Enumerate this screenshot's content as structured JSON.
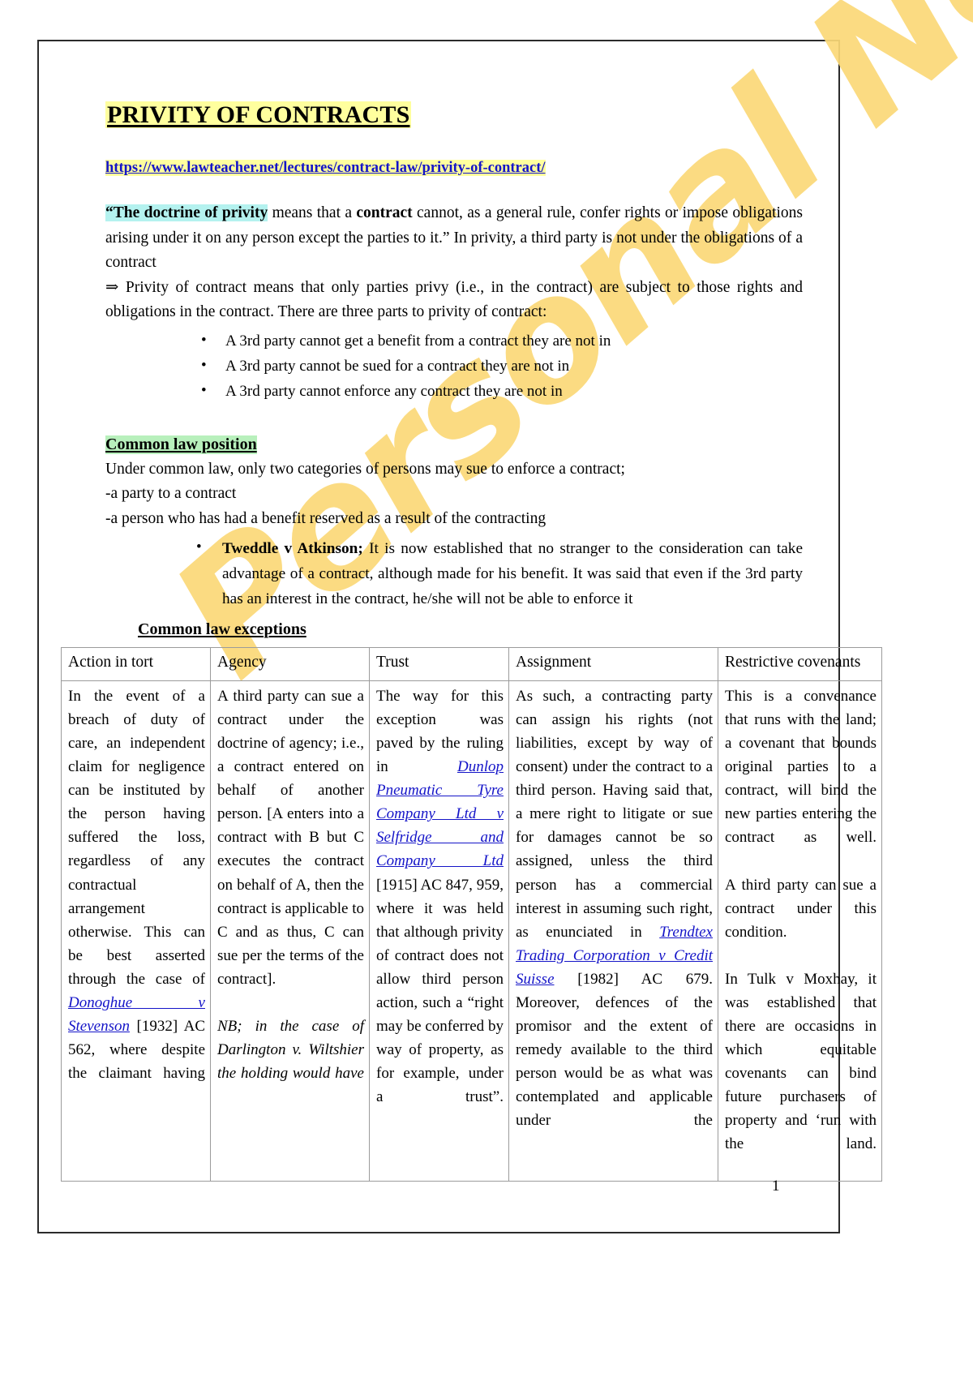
{
  "document": {
    "title": "PRIVITY OF CONTRACTS",
    "source_url": "https://www.lawteacher.net/lectures/contract-law/privity-of-contract/",
    "watermark": "Personal Notes",
    "page_number": "1",
    "colors": {
      "title_highlight": "#ffff9e",
      "url_highlight": "#ffff9e",
      "definition_highlight": "#b4f2ef",
      "section_highlight": "#b8f0bc",
      "link_blue": "#1414c8",
      "watermark": "#fbd978"
    }
  },
  "intro": {
    "definition_highlight": "“The doctrine of privity",
    "definition_rest_a": " means that a ",
    "definition_bold": "contract",
    "definition_rest_b": " cannot, as a general rule, confer rights or impose obligations arising under it on any person except the parties to it.” In privity, a third party is not under the obligations of a contract",
    "arrow_line": "⇒ Privity of contract means that only parties privy (i.e., in the contract) are subject to those rights and obligations in the contract. There are three parts to privity of contract:",
    "bullets": [
      "A 3rd party cannot get a benefit from a contract they are not in",
      "A 3rd party cannot be sued for a contract they are not in",
      "A 3rd party cannot enforce any contract they are not in"
    ]
  },
  "common_law": {
    "heading": "Common law position",
    "line1": "Under common law, only two categories of persons may sue to enforce a contract;",
    "line2": "-a party to a contract",
    "line3": "-a person who has had a benefit reserved as a result of the contracting",
    "case_bullet_bold": "Tweddle v Atkinson;",
    "case_bullet_text": " It is now established that no stranger to the consideration can take advantage of a contract, although made for his benefit. It was said that even if the 3rd party has an interest in the contract, he/she will not be able to enforce it"
  },
  "exceptions": {
    "heading": "Common law exceptions",
    "columns": [
      "Action in tort",
      "Agency",
      "Trust",
      "Assignment",
      "Restrictive covenants"
    ],
    "cells": {
      "action_in_tort": {
        "text_before_cite": "In the event of a breach of duty of care, an independent claim for negligence can be instituted by the person having suffered the loss, regardless of any contractual arrangement otherwise. This can be best asserted through the case of ",
        "cite": "Donoghue v Stevenson",
        "text_after_cite": " [1932] AC 562, where despite the claimant having"
      },
      "agency": {
        "text": "A third party can sue a contract under the doctrine of agency; i.e., a contract entered on behalf of another person. [A enters into a contract with B but C executes the contract on behalf of A, then the contract is applicable to C and as thus, C can sue per the terms of the contract].",
        "note_italic": "NB; in the case of Darlington v. Wiltshier the holding would have"
      },
      "trust": {
        "text_before_cite": "The way for this exception was paved by the ruling in ",
        "cite": "Dunlop Pneumatic Tyre Company Ltd v Selfridge and Company Ltd",
        "text_after_cite": " [1915] AC 847, 959, where it was held that although privity of contract does not allow third person action, such a “right may be conferred by way of property, as for example, under a trust”."
      },
      "assignment": {
        "text_before_cite": "As such, a contracting party can assign his rights (not liabilities, except by way of consent) under the contract to a third person. Having said that, a mere right to litigate or sue for damages cannot be so assigned, unless the third person has a commercial interest in assuming such right, as enunciated in ",
        "cite": "Trendtex Trading Corporation v Credit Suisse",
        "text_after_cite": " [1982] AC 679. Moreover, defences of the promisor and the extent of remedy available to the third person would be as what was contemplated and applicable under the"
      },
      "restrictive_covenants": {
        "para1": "This is a convenance that runs with the land; a covenant that bounds original parties to a contract, will bind the new parties entering the contract as well.",
        "para2": "A third party can sue a contract under this condition.",
        "para3": "In Tulk v Moxhay, it was established that there are occasions in which equitable covenants can bind future purchasers of property and ‘run with the land."
      }
    }
  }
}
